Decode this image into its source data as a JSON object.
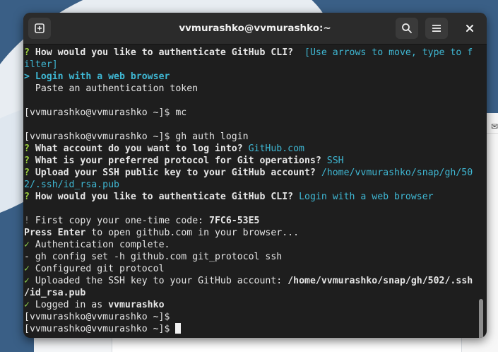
{
  "window": {
    "title": "vvmurashko@vvmurashko:~",
    "new_tab_icon": "new-tab-icon",
    "search_icon": "search-icon",
    "menu_icon": "hamburger-menu-icon",
    "close_icon": "close-icon"
  },
  "terminal": {
    "lines": {
      "l1a": "?",
      "l1b": " How would you like to authenticate GitHub CLI?",
      "l1c": "  [Use arrows to move, type to f",
      "l2": "ilter]",
      "l3a": ">",
      "l3b": " Login with a web browser",
      "l4": "  Paste an authentication token",
      "l6": "[vvmurashko@vvmurashko ~]$ mc",
      "l8": "[vvmurashko@vvmurashko ~]$ gh auth login",
      "l9a": "?",
      "l9b": " What account do you want to log into?",
      "l9c": " GitHub.com",
      "l10a": "?",
      "l10b": " What is your preferred protocol for Git operations?",
      "l10c": " SSH",
      "l11a": "?",
      "l11b": " Upload your SSH public key to your GitHub account?",
      "l11c": " /home/vvmurashko/snap/gh/50",
      "l12": "2/.ssh/id_rsa.pub",
      "l13a": "?",
      "l13b": " How would you like to authenticate GitHub CLI?",
      "l13c": " Login with a web browser",
      "l15a": "!",
      "l15b": " First copy your one-time code: ",
      "l15c": "7FC6-53E5",
      "l16a": "Press Enter",
      "l16b": " to open github.com in your browser...",
      "l17a": "✓",
      "l17b": " Authentication complete.",
      "l18": "- gh config set -h github.com git_protocol ssh",
      "l19a": "✓",
      "l19b": " Configured git protocol",
      "l20a": "✓",
      "l20b": " Uploaded the SSH key to your GitHub account: ",
      "l20c": "/home/vvmurashko/snap/gh/502/.ssh",
      "l21": "/id_rsa.pub",
      "l22a": "✓",
      "l22b": " Logged in as ",
      "l22c": "vvmurashko",
      "l23": "[vvmurashko@vvmurashko ~]$",
      "l24": "[vvmurashko@vvmurashko ~]$ "
    }
  },
  "colors": {
    "terminal_bg": "#1e1e1e",
    "prompt_green": "#9ed23f",
    "answer_cyan": "#3fb8d4"
  }
}
